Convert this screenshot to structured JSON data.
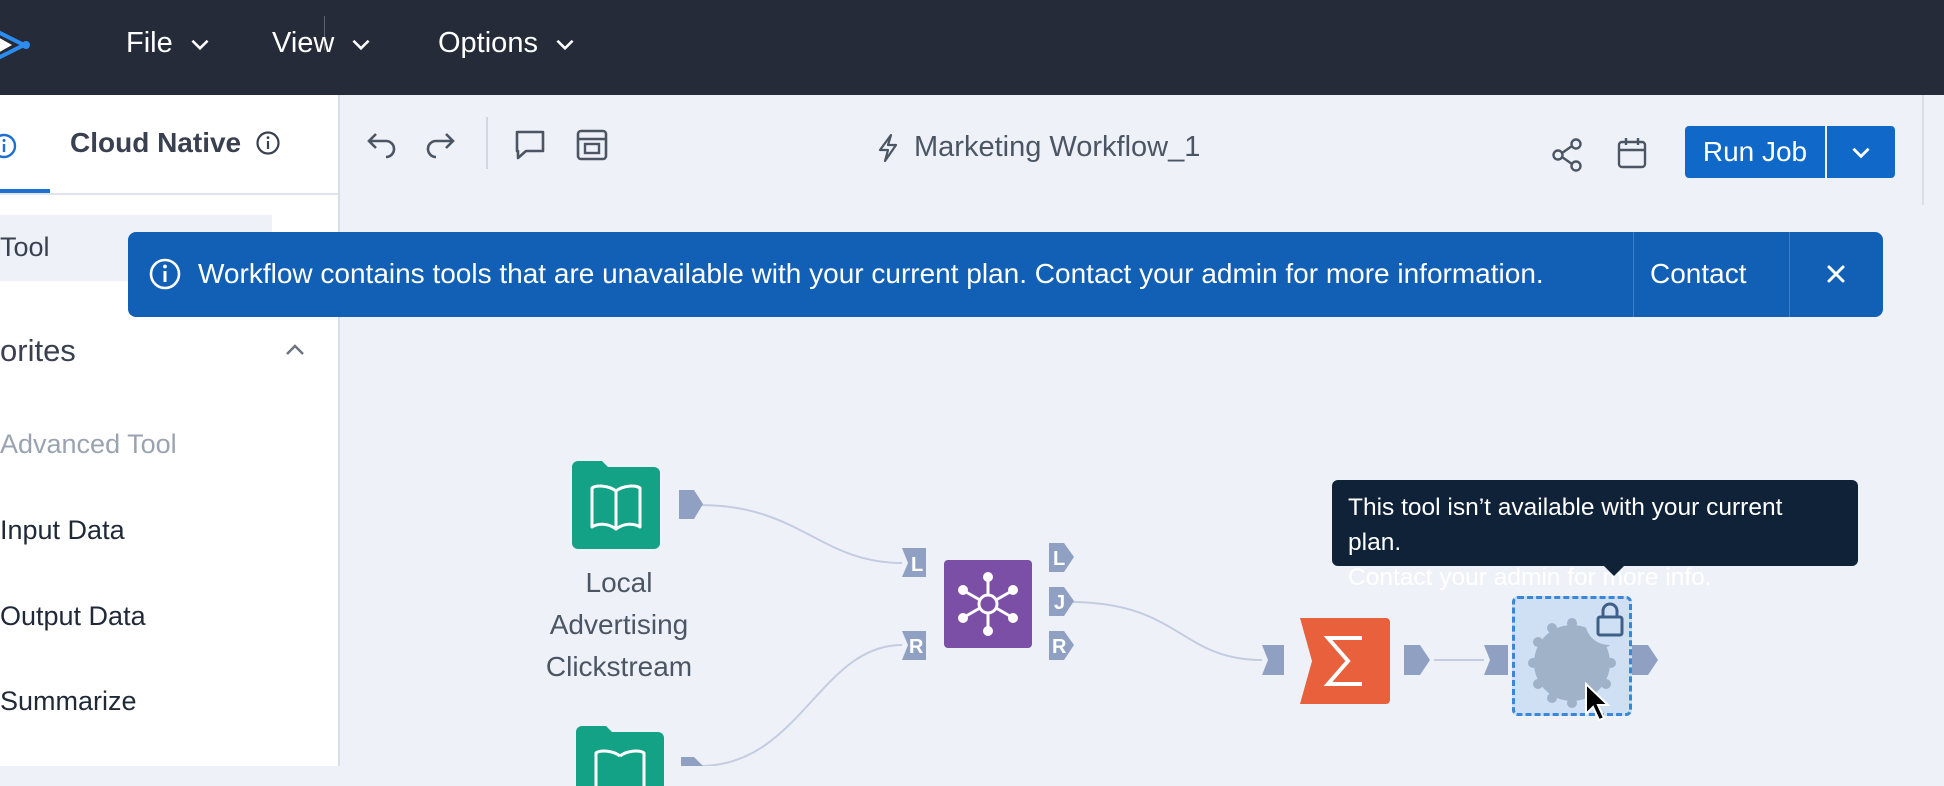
{
  "menu": {
    "file": "File",
    "view": "View",
    "options": "Options"
  },
  "sidebar": {
    "tab_label": "Cloud Native",
    "tool_label": "Tool",
    "favorites_label": "orites",
    "items": [
      {
        "label": "Advanced Tool",
        "disabled": true
      },
      {
        "label": "Input Data"
      },
      {
        "label": "Output Data"
      },
      {
        "label": "Summarize"
      }
    ]
  },
  "toolbar": {
    "workflow_name": "Marketing Workflow_1",
    "run_job_label": "Run Job"
  },
  "banner": {
    "message": "Workflow contains tools that are unavailable with your current plan. Contact your admin for more information.",
    "contact_label": "Contact"
  },
  "canvas": {
    "tool_local_ad_label": [
      "Local",
      "Advertising",
      "Clickstream"
    ],
    "join_anchors": {
      "left": "L",
      "right": "R",
      "out_left": "L",
      "out_join": "J",
      "out_right": "R"
    },
    "tooltip_lines": [
      "This tool isn’t available with your current plan.",
      "Contact your admin for more info."
    ]
  },
  "colors": {
    "topbar": "#252b38",
    "accent_blue": "#1068c9",
    "banner_blue": "#1260b5",
    "input_tool_teal": "#14a287",
    "join_tool_purple": "#7b4fa6",
    "summarize_tool_orange": "#e8603c",
    "anchor_gray": "#8fa0c2"
  }
}
